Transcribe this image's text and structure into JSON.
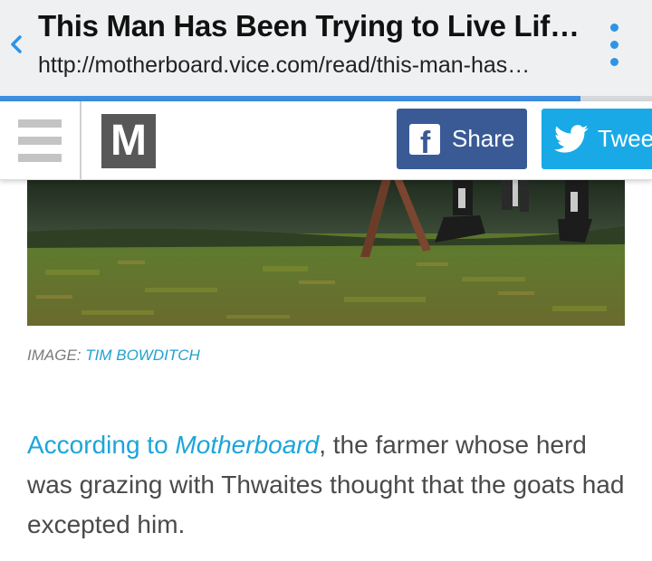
{
  "browser": {
    "page_title": "This Man Has Been Trying to Live Lif…",
    "url": "http://motherboard.vice.com/read/this-man-has…",
    "load_progress": 0.89
  },
  "site": {
    "logo_letter": "M",
    "share_facebook_label": "Share",
    "share_twitter_label": "Twee"
  },
  "article": {
    "caption_prefix": "IMAGE:",
    "caption_credit": "TIM BOWDITCH",
    "paragraph_link": "According to",
    "paragraph_link_em": "Motherboard",
    "paragraph_rest": ", the farmer whose herd was grazing with Thwaites thought that the goats had excepted him."
  },
  "colors": {
    "accent_blue": "#1da5d9",
    "facebook_blue": "#3a5a96",
    "twitter_blue": "#19a9e6",
    "menu_dots_blue": "#2f93e6"
  },
  "icons": {
    "back": "chevron-left-icon",
    "menu": "vertical-dots-icon",
    "hamburger": "hamburger-icon",
    "facebook": "facebook-icon",
    "twitter": "twitter-bird-icon"
  }
}
